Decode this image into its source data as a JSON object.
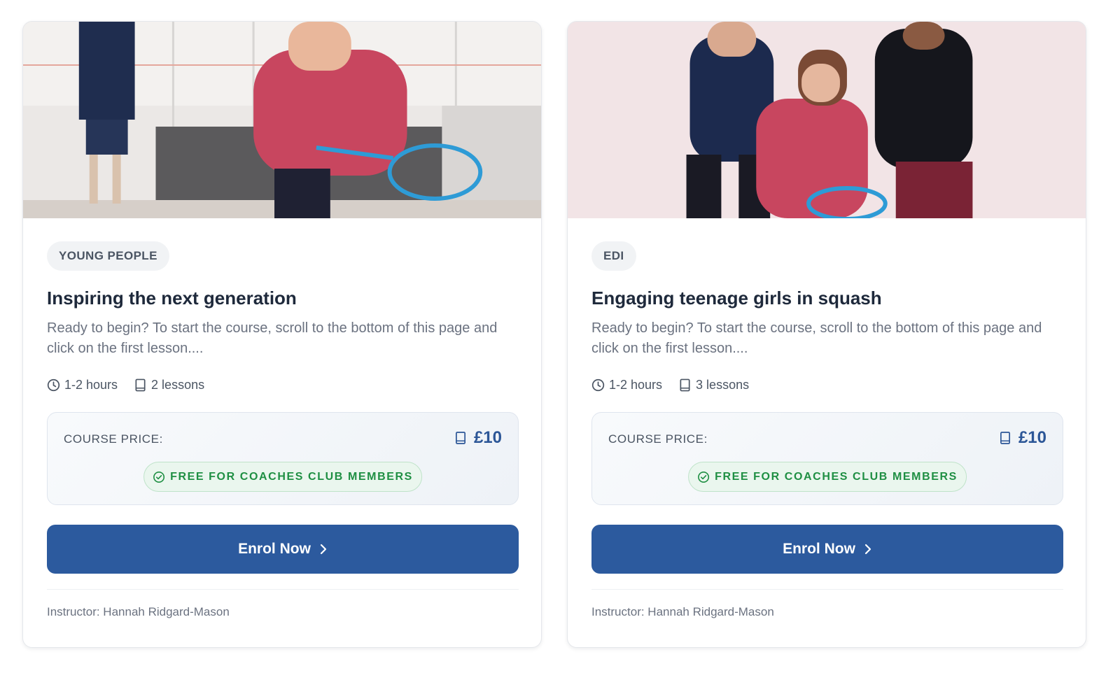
{
  "colors": {
    "accent": "#2c5a9e",
    "price": "#2c5697",
    "free_green": "#1f8f43",
    "free_bg": "#eaf6ee"
  },
  "cards": [
    {
      "image": "girl-swinging-squash-racket-photo",
      "tag": "YOUNG PEOPLE",
      "title": "Inspiring the next generation",
      "description": "Ready to begin? To start the course, scroll to the bottom of this page and click on the first lesson....",
      "duration": "1-2 hours",
      "lessons": "2 lessons",
      "price_label": "COURSE PRICE:",
      "price": "£10",
      "free_label": "FREE FOR COACHES CLUB MEMBERS",
      "enrol_label": "Enrol Now",
      "instructor": "Instructor: Hannah Ridgard-Mason"
    },
    {
      "image": "three-girls-laughing-against-wall-photo",
      "tag": "EDI",
      "title": "Engaging teenage girls in squash",
      "description": "Ready to begin? To start the course, scroll to the bottom of this page and click on the first lesson....",
      "duration": "1-2 hours",
      "lessons": "3 lessons",
      "price_label": "COURSE PRICE:",
      "price": "£10",
      "free_label": "FREE FOR COACHES CLUB MEMBERS",
      "enrol_label": "Enrol Now",
      "instructor": "Instructor: Hannah Ridgard-Mason"
    }
  ]
}
